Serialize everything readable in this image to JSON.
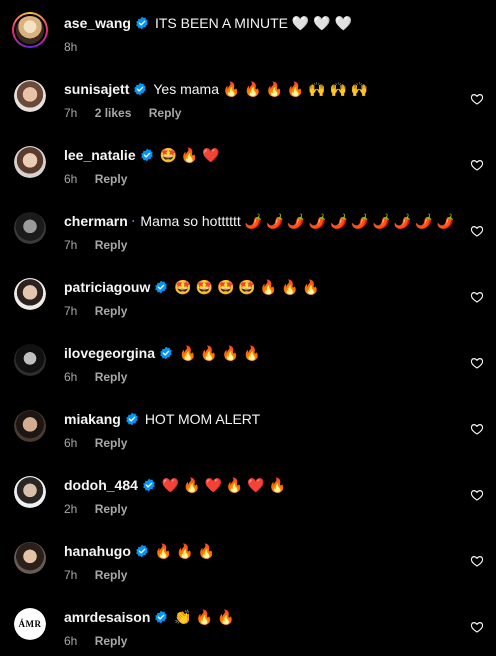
{
  "caption": {
    "username": "ase_wang",
    "text": "ITS BEEN A MINUTE 🤍 🤍 🤍",
    "time": "8h"
  },
  "comments": [
    {
      "username": "sunisajett",
      "text": "Yes mama 🔥 🔥 🔥 🔥 🙌 🙌 🙌",
      "time": "7h",
      "likes": "2 likes",
      "reply": "Reply"
    },
    {
      "username": "lee_natalie",
      "text": "🤩 🔥 ❤️",
      "time": "6h",
      "reply": "Reply"
    },
    {
      "username": "chermarn",
      "text": "Mama so hotttttt 🌶️ 🌶️ 🌶️ 🌶️ 🌶️ 🌶️ 🌶️ 🌶️ 🌶️ 🌶️",
      "time": "7h",
      "reply": "Reply"
    },
    {
      "username": "patriciagouw",
      "text": "🤩 🤩 🤩 🤩 🔥 🔥 🔥",
      "time": "7h",
      "reply": "Reply"
    },
    {
      "username": "ilovegeorgina",
      "text": "🔥 🔥 🔥 🔥",
      "time": "6h",
      "reply": "Reply"
    },
    {
      "username": "miakang",
      "text": "HOT MOM ALERT",
      "time": "6h",
      "reply": "Reply"
    },
    {
      "username": "dodoh_484",
      "text": "❤️ 🔥 ❤️ 🔥 ❤️ 🔥",
      "time": "2h",
      "reply": "Reply"
    },
    {
      "username": "hanahugo",
      "text": "🔥 🔥 🔥",
      "time": "7h",
      "reply": "Reply"
    },
    {
      "username": "amrdesaison",
      "text": "👏 🔥 🔥",
      "time": "6h",
      "reply": "Reply",
      "avatar_text": "ÁMR"
    }
  ],
  "colors": {
    "background": "#000000",
    "text": "#f5f5f5",
    "muted": "#a8a8a8",
    "verified": "#0095f6"
  }
}
